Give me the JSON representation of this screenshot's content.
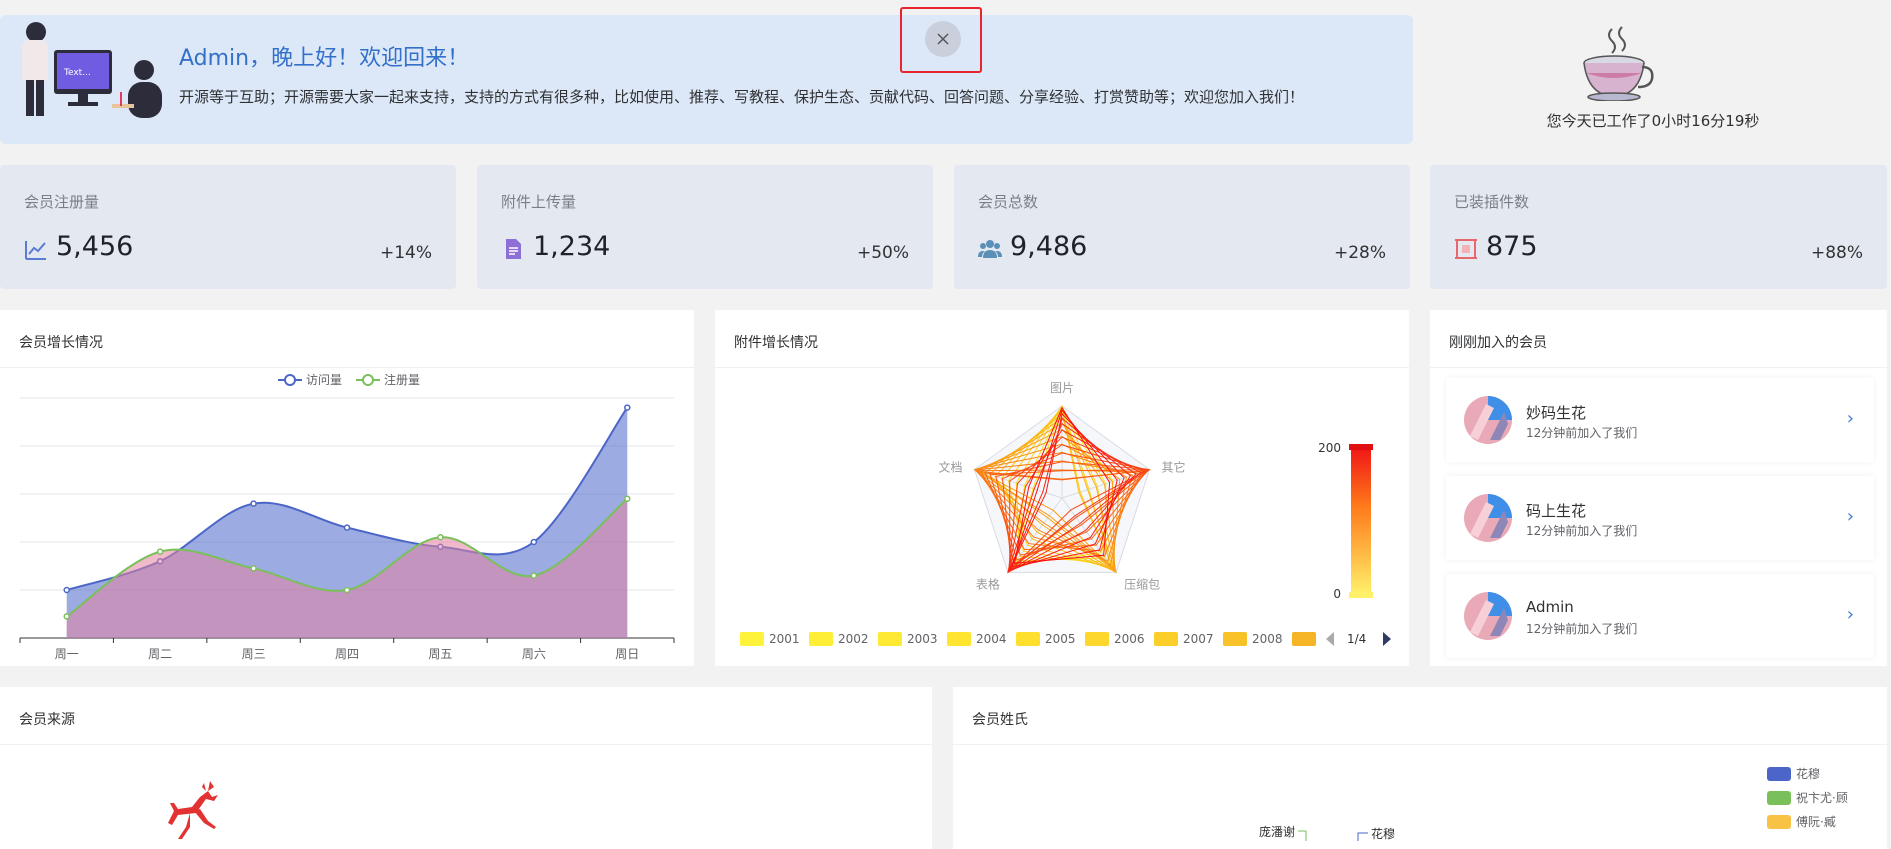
{
  "banner": {
    "title": "Admin，晚上好！欢迎回来！",
    "subtitle": "开源等于互助；开源需要大家一起来支持，支持的方式有很多种，比如使用、推荐、写教程、保护生态、贡献代码、回答问题、分享经验、打赏赞助等；欢迎您加入我们！",
    "illustration_text": "Text...",
    "close_icon": "close-icon"
  },
  "worktime": "您今天已工作了0小时16分19秒",
  "stats": [
    {
      "label": "会员注册量",
      "value": "5,456",
      "pct": "+14%",
      "icon": "line-chart-icon",
      "color": "#5b7bd5"
    },
    {
      "label": "附件上传量",
      "value": "1,234",
      "pct": "+50%",
      "icon": "file-icon",
      "color": "#8e6fd6"
    },
    {
      "label": "会员总数",
      "value": "9,486",
      "pct": "+28%",
      "icon": "users-icon",
      "color": "#5a8fb8"
    },
    {
      "label": "已装插件数",
      "value": "875",
      "pct": "+88%",
      "icon": "plugin-icon",
      "color": "#e8676c"
    }
  ],
  "growth": {
    "title": "会员增长情况",
    "chart_data": {
      "type": "area",
      "categories": [
        "周一",
        "周二",
        "周三",
        "周四",
        "周五",
        "周六",
        "周日"
      ],
      "series": [
        {
          "name": "访问量",
          "values": [
            100,
            160,
            280,
            230,
            190,
            200,
            480
          ],
          "color": "#4b66c8"
        },
        {
          "name": "注册量",
          "values": [
            45,
            180,
            145,
            100,
            210,
            130,
            290
          ],
          "color": "#7ac05a"
        }
      ],
      "ylim": [
        0,
        500
      ],
      "grid": true,
      "legend": "top-center"
    }
  },
  "attach": {
    "title": "附件增长情况",
    "chart_data": {
      "type": "radar",
      "indicators": [
        "图片",
        "其它",
        "压缩包",
        "表格",
        "文档"
      ],
      "legend_items": [
        "2001",
        "2002",
        "2003",
        "2004",
        "2005",
        "2006",
        "2007",
        "2008"
      ],
      "legend_page": "1/4",
      "visual_map": {
        "max": "200",
        "min": "0"
      }
    }
  },
  "members": {
    "title": "刚刚加入的会员",
    "items": [
      {
        "name": "妙码生花",
        "time": "12分钟前加入了我们"
      },
      {
        "name": "码上生花",
        "time": "12分钟前加入了我们"
      },
      {
        "name": "Admin",
        "time": "12分钟前加入了我们"
      }
    ],
    "chevron": "›"
  },
  "source": {
    "title": "会员来源"
  },
  "surname": {
    "title": "会员姓氏",
    "legend": [
      {
        "label": "花穆",
        "color": "#4b66c8"
      },
      {
        "label": "祝卞尤·顾",
        "color": "#7ac05a"
      },
      {
        "label": "傅阮·臧",
        "color": "#f7c245"
      }
    ],
    "tree_labels": [
      "庞潘谢",
      "花穆"
    ]
  }
}
